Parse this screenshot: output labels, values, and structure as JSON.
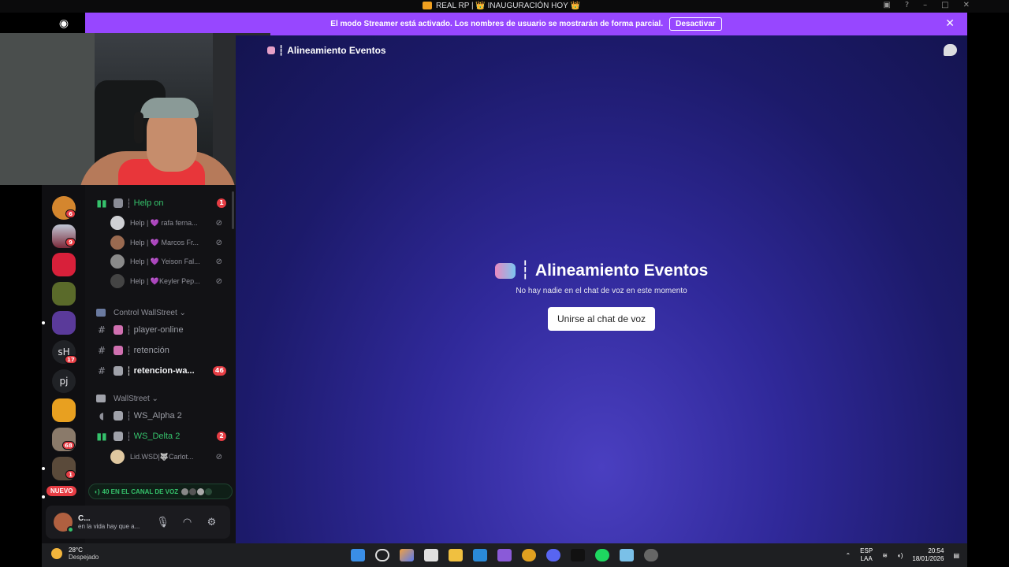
{
  "window": {
    "title": "REAL RP | 👑 INAUGURACIÓN HOY 👑"
  },
  "banner": {
    "message": "El modo Streamer está activado. Los nombres de usuario se mostrarán de forma parcial.",
    "button": "Desactivar"
  },
  "rail": {
    "badges": [
      "6",
      "9",
      "17",
      "68",
      "1"
    ],
    "text_servers": [
      "sH",
      "pj"
    ],
    "new_label": "NUEVO"
  },
  "sidebar": {
    "help_channel": {
      "name": "Help on",
      "mentions": "1"
    },
    "help_users": [
      "Help | 💜 rafa ferna...",
      "Help | 💜 Marcos Fr...",
      "Help | 💜 Yeison Fal...",
      "Help | 💜Keyler Pep..."
    ],
    "category_control": "Control WallStreet",
    "text_channels": [
      {
        "name": "player-online"
      },
      {
        "name": "retención"
      },
      {
        "name": "retencion-wa...",
        "mentions": "46"
      }
    ],
    "category_wallstreet": "WallStreet",
    "voice_channels": [
      {
        "name": "WS_Alpha 2"
      },
      {
        "name": "WS_Delta 2",
        "mentions": "2"
      }
    ],
    "delta_user": "Lid.WSD|🐺Carlot...",
    "voice_bar": "40 EN EL CANAL DE VOZ"
  },
  "user_panel": {
    "name": "C...",
    "status": "en la vida hay que a..."
  },
  "stage": {
    "header_title": "Alineamiento Eventos",
    "title": "Alineamiento Eventos",
    "subtitle": "No hay nadie en el chat de voz en este momento",
    "join_button": "Unirse al chat de voz"
  },
  "taskbar": {
    "temp": "28°C",
    "weather": "Despejado",
    "lang1": "ESP",
    "lang2": "LAA",
    "time": "20:54",
    "date": "18/01/2026"
  },
  "colors": {
    "accent": "#9747ff",
    "danger": "#e63d44",
    "voice_green": "#35c26b"
  }
}
